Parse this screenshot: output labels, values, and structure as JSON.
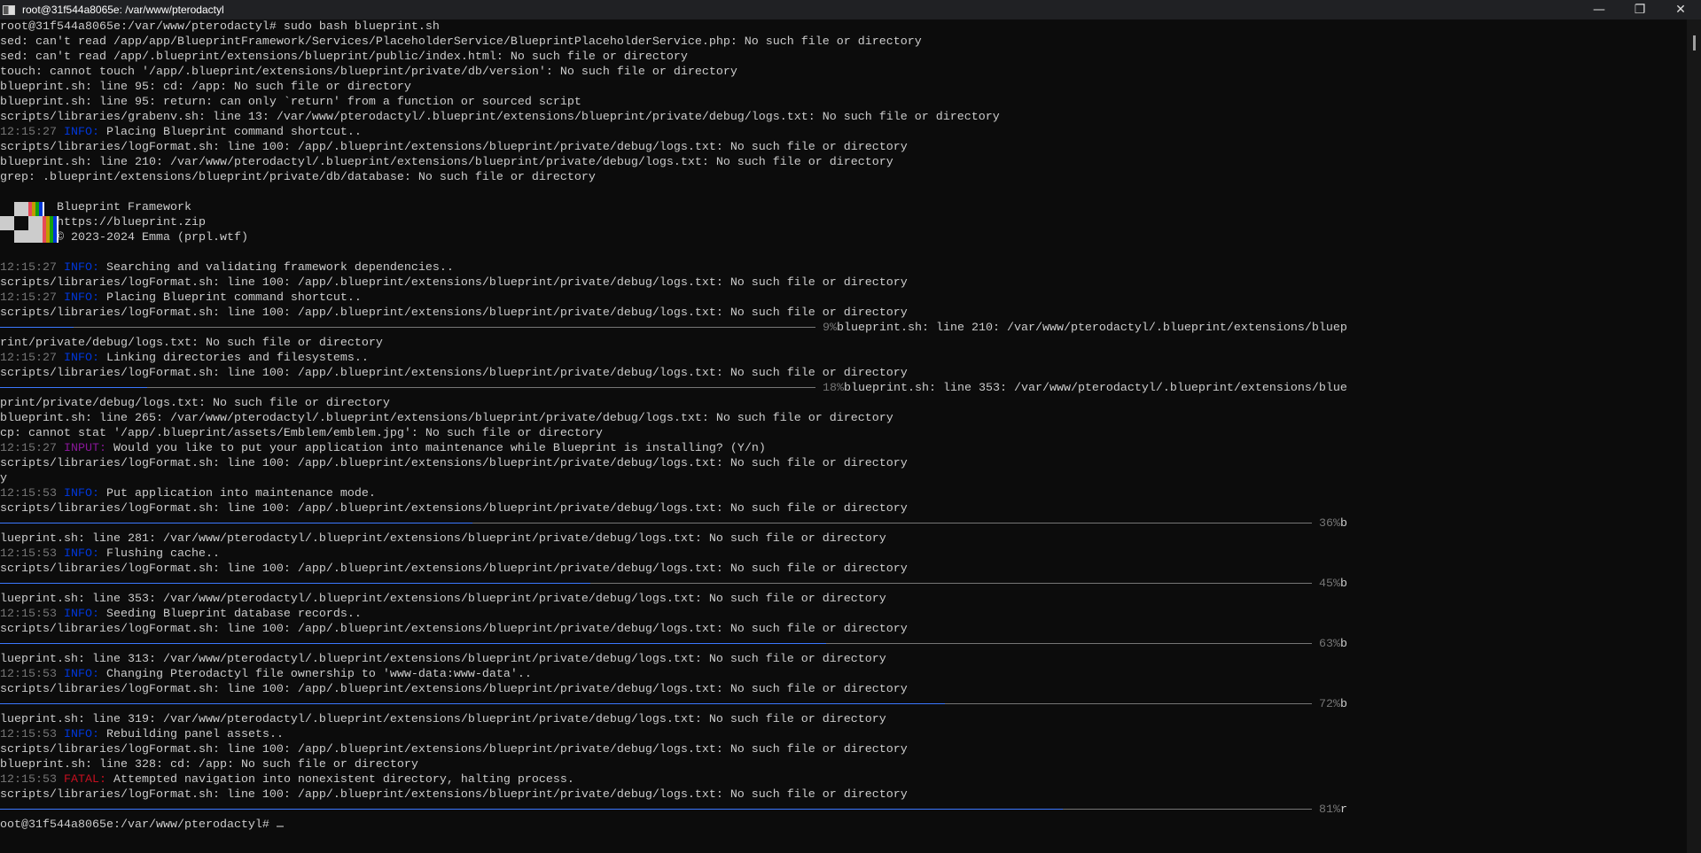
{
  "window": {
    "title": "root@31f544a8065e: /var/www/pterodactyl",
    "minimize": "—",
    "restore": "❐",
    "close": "✕"
  },
  "colors": {
    "background": "#0c0c0c",
    "text": "#cccccc",
    "timestamp": "#767676",
    "info": "#0037da",
    "input": "#881798",
    "fatal": "#c50f1f",
    "progress_fill": "#3b78ff",
    "progress_track": "#767676"
  },
  "logo": {
    "text": "Blueprint logo"
  },
  "lines": [
    {
      "segs": [
        {
          "t": "root@31f544a8065e:/var/www/pterodactyl# sudo bash blueprint.sh"
        }
      ]
    },
    {
      "segs": [
        {
          "t": "sed: can't read /app/app/BlueprintFramework/Services/PlaceholderService/BlueprintPlaceholderService.php: No such file or directory"
        }
      ]
    },
    {
      "segs": [
        {
          "t": "sed: can't read /app/.blueprint/extensions/blueprint/public/index.html: No such file or directory"
        }
      ]
    },
    {
      "segs": [
        {
          "t": "touch: cannot touch '/app/.blueprint/extensions/blueprint/private/db/version': No such file or directory"
        }
      ]
    },
    {
      "segs": [
        {
          "t": "blueprint.sh: line 95: cd: /app: No such file or directory"
        }
      ]
    },
    {
      "segs": [
        {
          "t": "blueprint.sh: line 95: return: can only `return' from a function or sourced script"
        }
      ]
    },
    {
      "segs": [
        {
          "t": "scripts/libraries/grabenv.sh: line 13: /var/www/pterodactyl/.blueprint/extensions/blueprint/private/debug/logs.txt: No such file or directory"
        }
      ]
    },
    {
      "segs": [
        {
          "t": "12:15:27 ",
          "c": "ts"
        },
        {
          "t": "INFO:",
          "c": "info"
        },
        {
          "t": " Placing Blueprint command shortcut.."
        }
      ]
    },
    {
      "segs": [
        {
          "t": "scripts/libraries/logFormat.sh: line 100: /app/.blueprint/extensions/blueprint/private/debug/logs.txt: No such file or directory"
        }
      ]
    },
    {
      "segs": [
        {
          "t": "blueprint.sh: line 210: /var/www/pterodactyl/.blueprint/extensions/blueprint/private/debug/logs.txt: No such file or directory"
        }
      ]
    },
    {
      "segs": [
        {
          "t": "grep: .blueprint/extensions/blueprint/private/db/database: No such file or directory"
        }
      ]
    },
    {
      "segs": []
    },
    {
      "segs": [
        {
          "t": "        Blueprint Framework"
        }
      ],
      "logo": true
    },
    {
      "segs": [
        {
          "t": "        https://blueprint.zip"
        }
      ]
    },
    {
      "segs": [
        {
          "t": "        © 2023-2024 Emma (prpl.wtf)"
        }
      ]
    },
    {
      "segs": []
    },
    {
      "segs": [
        {
          "t": "12:15:27 ",
          "c": "ts"
        },
        {
          "t": "INFO:",
          "c": "info"
        },
        {
          "t": " Searching and validating framework dependencies.."
        }
      ]
    },
    {
      "segs": [
        {
          "t": "scripts/libraries/logFormat.sh: line 100: /app/.blueprint/extensions/blueprint/private/debug/logs.txt: No such file or directory"
        }
      ]
    },
    {
      "segs": [
        {
          "t": "12:15:27 ",
          "c": "ts"
        },
        {
          "t": "INFO:",
          "c": "info"
        },
        {
          "t": " Placing Blueprint command shortcut.."
        }
      ]
    },
    {
      "segs": [
        {
          "t": "scripts/libraries/logFormat.sh: line 100: /app/.blueprint/extensions/blueprint/private/debug/logs.txt: No such file or directory"
        }
      ]
    },
    {
      "bar": {
        "percent": 9,
        "label": "9%",
        "tail": "blueprint.sh: line 210: /var/www/pterodactyl/.blueprint/extensions/bluep"
      }
    },
    {
      "segs": [
        {
          "t": "rint/private/debug/logs.txt: No such file or directory"
        }
      ]
    },
    {
      "segs": [
        {
          "t": "12:15:27 ",
          "c": "ts"
        },
        {
          "t": "INFO:",
          "c": "info"
        },
        {
          "t": " Linking directories and filesystems.."
        }
      ]
    },
    {
      "segs": [
        {
          "t": "scripts/libraries/logFormat.sh: line 100: /app/.blueprint/extensions/blueprint/private/debug/logs.txt: No such file or directory"
        }
      ]
    },
    {
      "bar": {
        "percent": 18,
        "label": "18%",
        "tail": "blueprint.sh: line 353: /var/www/pterodactyl/.blueprint/extensions/blue"
      }
    },
    {
      "segs": [
        {
          "t": "print/private/debug/logs.txt: No such file or directory"
        }
      ]
    },
    {
      "segs": [
        {
          "t": "blueprint.sh: line 265: /var/www/pterodactyl/.blueprint/extensions/blueprint/private/debug/logs.txt: No such file or directory"
        }
      ]
    },
    {
      "segs": [
        {
          "t": "cp: cannot stat '/app/.blueprint/assets/Emblem/emblem.jpg': No such file or directory"
        }
      ]
    },
    {
      "segs": [
        {
          "t": "12:15:27 ",
          "c": "ts"
        },
        {
          "t": "INPUT:",
          "c": "input"
        },
        {
          "t": " Would you like to put your application into maintenance while Blueprint is installing? (Y/n)"
        }
      ]
    },
    {
      "segs": [
        {
          "t": "scripts/libraries/logFormat.sh: line 100: /app/.blueprint/extensions/blueprint/private/debug/logs.txt: No such file or directory"
        }
      ]
    },
    {
      "segs": [
        {
          "t": "y"
        }
      ]
    },
    {
      "segs": [
        {
          "t": "12:15:53 ",
          "c": "ts"
        },
        {
          "t": "INFO:",
          "c": "info"
        },
        {
          "t": " Put application into maintenance mode."
        }
      ]
    },
    {
      "segs": [
        {
          "t": "scripts/libraries/logFormat.sh: line 100: /app/.blueprint/extensions/blueprint/private/debug/logs.txt: No such file or directory"
        }
      ]
    },
    {
      "bar": {
        "percent": 36,
        "label": "36%",
        "tail": "b"
      }
    },
    {
      "segs": [
        {
          "t": "lueprint.sh: line 281: /var/www/pterodactyl/.blueprint/extensions/blueprint/private/debug/logs.txt: No such file or directory"
        }
      ]
    },
    {
      "segs": [
        {
          "t": "12:15:53 ",
          "c": "ts"
        },
        {
          "t": "INFO:",
          "c": "info"
        },
        {
          "t": " Flushing cache.."
        }
      ]
    },
    {
      "segs": [
        {
          "t": "scripts/libraries/logFormat.sh: line 100: /app/.blueprint/extensions/blueprint/private/debug/logs.txt: No such file or directory"
        }
      ]
    },
    {
      "bar": {
        "percent": 45,
        "label": "45%",
        "tail": "b"
      }
    },
    {
      "segs": [
        {
          "t": "lueprint.sh: line 353: /var/www/pterodactyl/.blueprint/extensions/blueprint/private/debug/logs.txt: No such file or directory"
        }
      ]
    },
    {
      "segs": [
        {
          "t": "12:15:53 ",
          "c": "ts"
        },
        {
          "t": "INFO:",
          "c": "info"
        },
        {
          "t": " Seeding Blueprint database records.."
        }
      ]
    },
    {
      "segs": [
        {
          "t": "scripts/libraries/logFormat.sh: line 100: /app/.blueprint/extensions/blueprint/private/debug/logs.txt: No such file or directory"
        }
      ]
    },
    {
      "bar": {
        "percent": 63,
        "label": "63%",
        "tail": "b"
      }
    },
    {
      "segs": [
        {
          "t": "lueprint.sh: line 313: /var/www/pterodactyl/.blueprint/extensions/blueprint/private/debug/logs.txt: No such file or directory"
        }
      ]
    },
    {
      "segs": [
        {
          "t": "12:15:53 ",
          "c": "ts"
        },
        {
          "t": "INFO:",
          "c": "info"
        },
        {
          "t": " Changing Pterodactyl file ownership to 'www-data:www-data'.."
        }
      ]
    },
    {
      "segs": [
        {
          "t": "scripts/libraries/logFormat.sh: line 100: /app/.blueprint/extensions/blueprint/private/debug/logs.txt: No such file or directory"
        }
      ]
    },
    {
      "bar": {
        "percent": 72,
        "label": "72%",
        "tail": "b"
      }
    },
    {
      "segs": [
        {
          "t": "lueprint.sh: line 319: /var/www/pterodactyl/.blueprint/extensions/blueprint/private/debug/logs.txt: No such file or directory"
        }
      ]
    },
    {
      "segs": [
        {
          "t": "12:15:53 ",
          "c": "ts"
        },
        {
          "t": "INFO:",
          "c": "info"
        },
        {
          "t": " Rebuilding panel assets.."
        }
      ]
    },
    {
      "segs": [
        {
          "t": "scripts/libraries/logFormat.sh: line 100: /app/.blueprint/extensions/blueprint/private/debug/logs.txt: No such file or directory"
        }
      ]
    },
    {
      "segs": [
        {
          "t": "blueprint.sh: line 328: cd: /app: No such file or directory"
        }
      ]
    },
    {
      "segs": [
        {
          "t": "12:15:53 ",
          "c": "ts"
        },
        {
          "t": "FATAL:",
          "c": "fatal"
        },
        {
          "t": " Attempted navigation into nonexistent directory, halting process."
        }
      ]
    },
    {
      "segs": [
        {
          "t": "scripts/libraries/logFormat.sh: line 100: /app/.blueprint/extensions/blueprint/private/debug/logs.txt: No such file or directory"
        }
      ]
    },
    {
      "bar": {
        "percent": 81,
        "label": "81%",
        "tail": "r"
      }
    },
    {
      "segs": [
        {
          "t": "oot@31f544a8065e:/var/www/pterodactyl# "
        }
      ],
      "cursor": true
    }
  ]
}
